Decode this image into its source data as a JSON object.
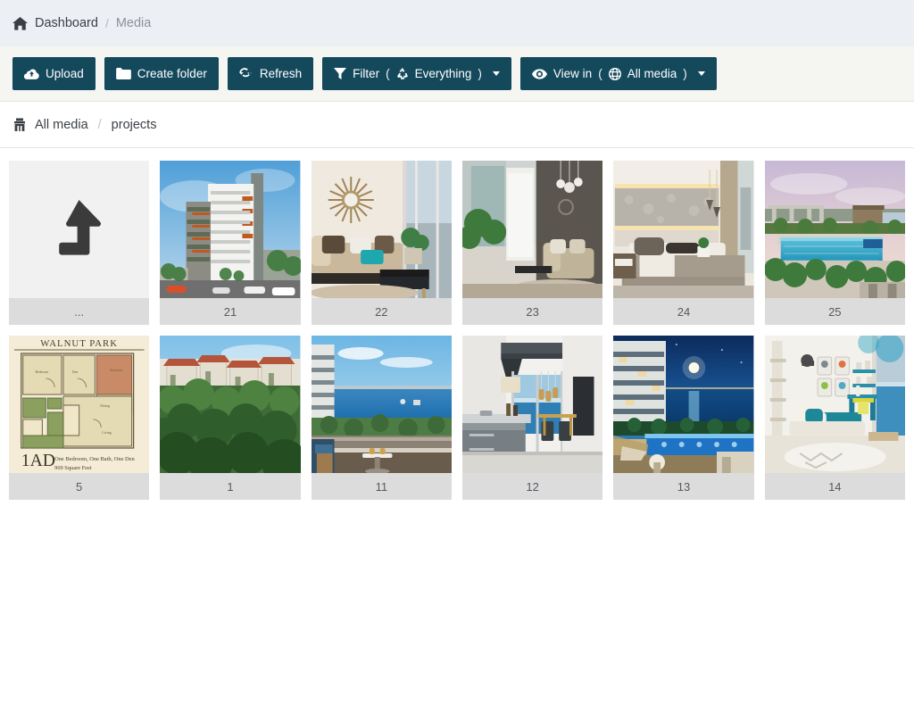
{
  "breadcrumb": {
    "home_icon": "home-icon",
    "home_label": "Dashboard",
    "separator": "/",
    "current": "Media"
  },
  "toolbar": {
    "buttons": [
      {
        "id": "upload",
        "label": "Upload",
        "icon": "cloud-upload-icon",
        "has_caret": false
      },
      {
        "id": "create-folder",
        "label": "Create folder",
        "icon": "folder-icon",
        "has_caret": false
      },
      {
        "id": "refresh",
        "label": "Refresh",
        "icon": "refresh-icon",
        "has_caret": false
      }
    ],
    "filter": {
      "label": "Filter",
      "open_paren": "(",
      "icon": "recycle-icon",
      "value": "Everything",
      "close_paren": ")",
      "caret": true
    },
    "view_in": {
      "label": "View in",
      "open_paren": "(",
      "icon": "globe-icon",
      "value": "All media",
      "close_paren": ")",
      "caret": true
    },
    "button_color": "#14495c",
    "bar_color": "#f5f5f2"
  },
  "path": {
    "root_icon": "archive-icon",
    "root_label": "All media",
    "separator": "/",
    "current_folder": "projects"
  },
  "grid": {
    "parent_tile": {
      "icon": "level-up-icon",
      "caption": "..."
    },
    "items": [
      {
        "caption": "21",
        "art": "highrise-tower",
        "alt": "Residential high-rise tower exterior render"
      },
      {
        "caption": "22",
        "art": "living-room-sun",
        "alt": "Living room with sunburst mirror and beige sofa"
      },
      {
        "caption": "23",
        "art": "living-room-green",
        "alt": "Living room with pendant light and balcony greenery"
      },
      {
        "caption": "24",
        "art": "bedroom-grey",
        "alt": "Master bedroom with backlit textured headboard wall"
      },
      {
        "caption": "25",
        "art": "rooftop-pool",
        "alt": "Rooftop swimming pool at dusk with pergola"
      },
      {
        "caption": "5",
        "art": "floorplan",
        "alt": "Walnut Park unit floor plan 1AD"
      },
      {
        "caption": "1",
        "art": "hillside-villas",
        "alt": "Hillside villas surrounded by trees"
      },
      {
        "caption": "11",
        "art": "balcony-sea",
        "alt": "Balcony overlooking the sea and park"
      },
      {
        "caption": "12",
        "art": "kitchen-sea",
        "alt": "Modern kitchen with sea view"
      },
      {
        "caption": "13",
        "art": "night-resort",
        "alt": "Resort pool at night with moonlit bay"
      },
      {
        "caption": "14",
        "art": "kids-bedroom",
        "alt": "Kids bedroom in teal with loft ladder"
      }
    ],
    "caption_bg": "#dcdcdc"
  },
  "floorplan_text": {
    "title": "WALNUT PARK",
    "code": "1AD",
    "desc": "One Bedroom, One Bath, One Den"
  }
}
